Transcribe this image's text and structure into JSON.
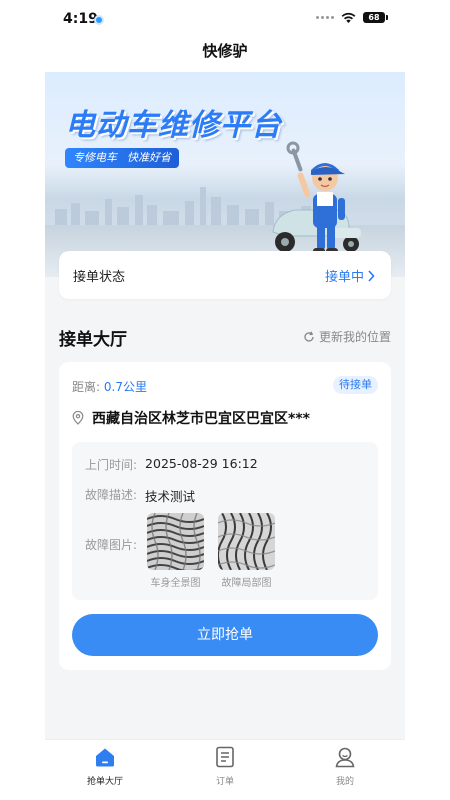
{
  "status_bar": {
    "time": "4:19",
    "battery": "68"
  },
  "nav": {
    "title": "快修驴"
  },
  "banner": {
    "headline": "电动车维修平台",
    "tag1": "专修电车",
    "tag2": "快准好省"
  },
  "order_status": {
    "label": "接单状态",
    "value": "接单中"
  },
  "hall": {
    "title": "接单大厅",
    "refresh_label": "更新我的位置"
  },
  "order": {
    "distance_label": "距离:",
    "distance_value": "0.7公里",
    "badge": "待接单",
    "address": "西藏自治区林芝市巴宜区巴宜区***",
    "visit_time_label": "上门时间:",
    "visit_time_value": "2025-08-29 16:12",
    "fault_desc_label": "故障描述:",
    "fault_desc_value": "技术测试",
    "fault_pics_label": "故障图片:",
    "pics": [
      {
        "caption": "车身全景图"
      },
      {
        "caption": "故障局部图"
      }
    ],
    "grab_button": "立即抢单"
  },
  "tabbar": {
    "items": [
      {
        "label": "抢单大厅",
        "icon": "home-icon",
        "active": true
      },
      {
        "label": "订单",
        "icon": "order-list-icon",
        "active": false
      },
      {
        "label": "我的",
        "icon": "profile-icon",
        "active": false
      }
    ]
  },
  "colors": {
    "accent": "#3a8cf5",
    "link": "#2a7af3",
    "background": "#f4f5f7"
  }
}
